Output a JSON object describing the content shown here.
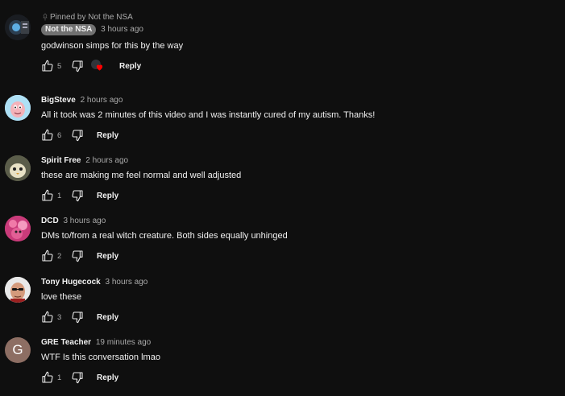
{
  "colors": {
    "background": "#0f0f0f",
    "text": "#f1f1f1",
    "secondary": "#aaaaaa",
    "owner_badge": "#717171",
    "heart": "#ff0000"
  },
  "pinned": {
    "label": "Pinned by Not the NSA",
    "icon": "pin-icon"
  },
  "comments": [
    {
      "author": "Not the NSA",
      "is_owner": true,
      "time": "3 hours ago",
      "text": "godwinson simps for this by the way",
      "likes": "5",
      "reply": "Reply",
      "creator_heart": true
    },
    {
      "author": "BigSteve",
      "time": "2 hours ago",
      "text": "All it took was 2 minutes of this video and I was instantly cured of my autism.  Thanks!",
      "likes": "6",
      "reply": "Reply"
    },
    {
      "author": "Spirit Free",
      "time": "2 hours ago",
      "text": "these are making me feel normal and well adjusted",
      "likes": "1",
      "reply": "Reply"
    },
    {
      "author": "DCD",
      "time": "3 hours ago",
      "text": "DMs to/from a real witch creature. Both sides equally unhinged",
      "likes": "2",
      "reply": "Reply"
    },
    {
      "author": "Tony Hugecock",
      "time": "3 hours ago",
      "text": "love these",
      "likes": "3",
      "reply": "Reply"
    },
    {
      "author": "GRE Teacher",
      "time": "19 minutes ago",
      "text": "WTF Is this conversation lmao",
      "likes": "1",
      "reply": "Reply",
      "avatar_letter": "G",
      "avatar_color": "#8d6e63"
    }
  ]
}
